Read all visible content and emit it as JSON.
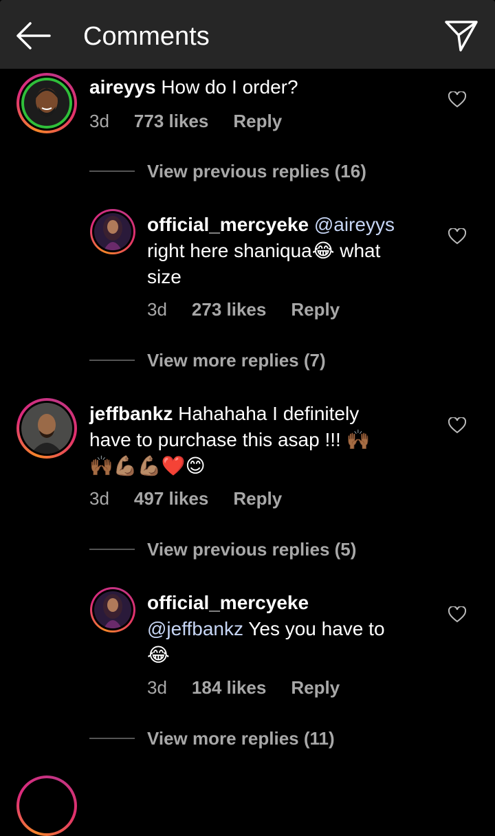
{
  "header": {
    "title": "Comments",
    "back_icon": "arrow-left-icon",
    "send_icon": "paper-plane-icon"
  },
  "comments": [
    {
      "username": "aireyys",
      "text": "How do I order?",
      "age": "3d",
      "likes": "773 likes",
      "reply": "Reply",
      "thread_link": "View previous replies (16)"
    },
    {
      "username": "official_mercyeke",
      "mention": "@aireyys",
      "text_line1": "right here shaniqua",
      "emoji1": "😂",
      "text_line1b": "what",
      "text_line2": "size",
      "age": "3d",
      "likes": "273 likes",
      "reply": "Reply",
      "thread_link": "View more replies (7)"
    },
    {
      "username": "jeffbankz",
      "text_line1": "Hahahaha I definitely",
      "text_line2": "have to purchase this asap !!!",
      "emoji_line2": "🙌🏾",
      "emoji_line3": "🙌🏾💪🏽💪🏽❤️😊",
      "age": "3d",
      "likes": "497 likes",
      "reply": "Reply",
      "thread_link": "View previous replies (5)"
    },
    {
      "username": "official_mercyeke",
      "mention": "@jeffbankz",
      "text": "Yes you have to",
      "emoji": "😂",
      "age": "3d",
      "likes": "184 likes",
      "reply": "Reply",
      "thread_link": "View more replies (11)"
    }
  ],
  "colors": {
    "background": "#000000",
    "header": "#262626",
    "secondary_text": "#a8a8a8",
    "mention": "#c7d6f5"
  }
}
